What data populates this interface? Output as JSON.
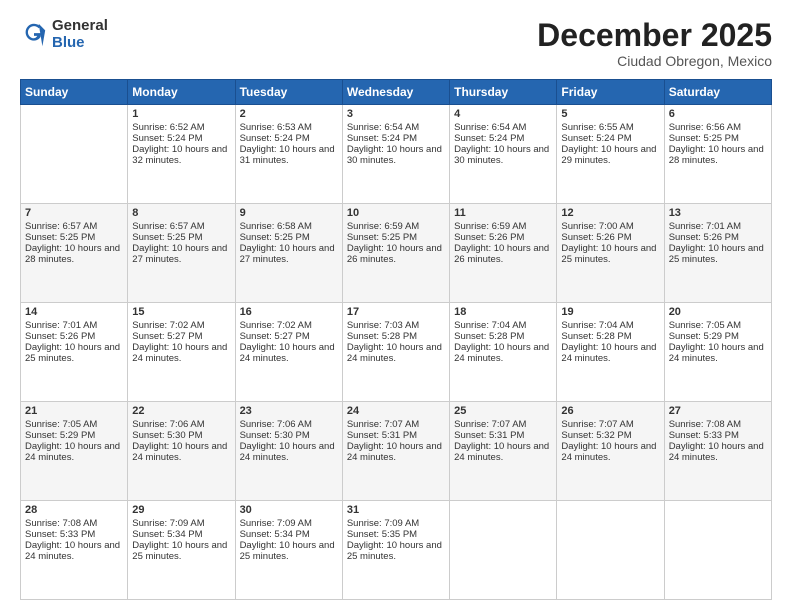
{
  "logo": {
    "general": "General",
    "blue": "Blue"
  },
  "header": {
    "month": "December 2025",
    "location": "Ciudad Obregon, Mexico"
  },
  "days_of_week": [
    "Sunday",
    "Monday",
    "Tuesday",
    "Wednesday",
    "Thursday",
    "Friday",
    "Saturday"
  ],
  "weeks": [
    [
      {
        "day": "",
        "sunrise": "",
        "sunset": "",
        "daylight": "",
        "empty": true
      },
      {
        "day": "1",
        "sunrise": "Sunrise: 6:52 AM",
        "sunset": "Sunset: 5:24 PM",
        "daylight": "Daylight: 10 hours and 32 minutes."
      },
      {
        "day": "2",
        "sunrise": "Sunrise: 6:53 AM",
        "sunset": "Sunset: 5:24 PM",
        "daylight": "Daylight: 10 hours and 31 minutes."
      },
      {
        "day": "3",
        "sunrise": "Sunrise: 6:54 AM",
        "sunset": "Sunset: 5:24 PM",
        "daylight": "Daylight: 10 hours and 30 minutes."
      },
      {
        "day": "4",
        "sunrise": "Sunrise: 6:54 AM",
        "sunset": "Sunset: 5:24 PM",
        "daylight": "Daylight: 10 hours and 30 minutes."
      },
      {
        "day": "5",
        "sunrise": "Sunrise: 6:55 AM",
        "sunset": "Sunset: 5:24 PM",
        "daylight": "Daylight: 10 hours and 29 minutes."
      },
      {
        "day": "6",
        "sunrise": "Sunrise: 6:56 AM",
        "sunset": "Sunset: 5:25 PM",
        "daylight": "Daylight: 10 hours and 28 minutes."
      }
    ],
    [
      {
        "day": "7",
        "sunrise": "Sunrise: 6:57 AM",
        "sunset": "Sunset: 5:25 PM",
        "daylight": "Daylight: 10 hours and 28 minutes."
      },
      {
        "day": "8",
        "sunrise": "Sunrise: 6:57 AM",
        "sunset": "Sunset: 5:25 PM",
        "daylight": "Daylight: 10 hours and 27 minutes."
      },
      {
        "day": "9",
        "sunrise": "Sunrise: 6:58 AM",
        "sunset": "Sunset: 5:25 PM",
        "daylight": "Daylight: 10 hours and 27 minutes."
      },
      {
        "day": "10",
        "sunrise": "Sunrise: 6:59 AM",
        "sunset": "Sunset: 5:25 PM",
        "daylight": "Daylight: 10 hours and 26 minutes."
      },
      {
        "day": "11",
        "sunrise": "Sunrise: 6:59 AM",
        "sunset": "Sunset: 5:26 PM",
        "daylight": "Daylight: 10 hours and 26 minutes."
      },
      {
        "day": "12",
        "sunrise": "Sunrise: 7:00 AM",
        "sunset": "Sunset: 5:26 PM",
        "daylight": "Daylight: 10 hours and 25 minutes."
      },
      {
        "day": "13",
        "sunrise": "Sunrise: 7:01 AM",
        "sunset": "Sunset: 5:26 PM",
        "daylight": "Daylight: 10 hours and 25 minutes."
      }
    ],
    [
      {
        "day": "14",
        "sunrise": "Sunrise: 7:01 AM",
        "sunset": "Sunset: 5:26 PM",
        "daylight": "Daylight: 10 hours and 25 minutes."
      },
      {
        "day": "15",
        "sunrise": "Sunrise: 7:02 AM",
        "sunset": "Sunset: 5:27 PM",
        "daylight": "Daylight: 10 hours and 24 minutes."
      },
      {
        "day": "16",
        "sunrise": "Sunrise: 7:02 AM",
        "sunset": "Sunset: 5:27 PM",
        "daylight": "Daylight: 10 hours and 24 minutes."
      },
      {
        "day": "17",
        "sunrise": "Sunrise: 7:03 AM",
        "sunset": "Sunset: 5:28 PM",
        "daylight": "Daylight: 10 hours and 24 minutes."
      },
      {
        "day": "18",
        "sunrise": "Sunrise: 7:04 AM",
        "sunset": "Sunset: 5:28 PM",
        "daylight": "Daylight: 10 hours and 24 minutes."
      },
      {
        "day": "19",
        "sunrise": "Sunrise: 7:04 AM",
        "sunset": "Sunset: 5:28 PM",
        "daylight": "Daylight: 10 hours and 24 minutes."
      },
      {
        "day": "20",
        "sunrise": "Sunrise: 7:05 AM",
        "sunset": "Sunset: 5:29 PM",
        "daylight": "Daylight: 10 hours and 24 minutes."
      }
    ],
    [
      {
        "day": "21",
        "sunrise": "Sunrise: 7:05 AM",
        "sunset": "Sunset: 5:29 PM",
        "daylight": "Daylight: 10 hours and 24 minutes."
      },
      {
        "day": "22",
        "sunrise": "Sunrise: 7:06 AM",
        "sunset": "Sunset: 5:30 PM",
        "daylight": "Daylight: 10 hours and 24 minutes."
      },
      {
        "day": "23",
        "sunrise": "Sunrise: 7:06 AM",
        "sunset": "Sunset: 5:30 PM",
        "daylight": "Daylight: 10 hours and 24 minutes."
      },
      {
        "day": "24",
        "sunrise": "Sunrise: 7:07 AM",
        "sunset": "Sunset: 5:31 PM",
        "daylight": "Daylight: 10 hours and 24 minutes."
      },
      {
        "day": "25",
        "sunrise": "Sunrise: 7:07 AM",
        "sunset": "Sunset: 5:31 PM",
        "daylight": "Daylight: 10 hours and 24 minutes."
      },
      {
        "day": "26",
        "sunrise": "Sunrise: 7:07 AM",
        "sunset": "Sunset: 5:32 PM",
        "daylight": "Daylight: 10 hours and 24 minutes."
      },
      {
        "day": "27",
        "sunrise": "Sunrise: 7:08 AM",
        "sunset": "Sunset: 5:33 PM",
        "daylight": "Daylight: 10 hours and 24 minutes."
      }
    ],
    [
      {
        "day": "28",
        "sunrise": "Sunrise: 7:08 AM",
        "sunset": "Sunset: 5:33 PM",
        "daylight": "Daylight: 10 hours and 24 minutes."
      },
      {
        "day": "29",
        "sunrise": "Sunrise: 7:09 AM",
        "sunset": "Sunset: 5:34 PM",
        "daylight": "Daylight: 10 hours and 25 minutes."
      },
      {
        "day": "30",
        "sunrise": "Sunrise: 7:09 AM",
        "sunset": "Sunset: 5:34 PM",
        "daylight": "Daylight: 10 hours and 25 minutes."
      },
      {
        "day": "31",
        "sunrise": "Sunrise: 7:09 AM",
        "sunset": "Sunset: 5:35 PM",
        "daylight": "Daylight: 10 hours and 25 minutes."
      },
      {
        "day": "",
        "sunrise": "",
        "sunset": "",
        "daylight": "",
        "empty": true
      },
      {
        "day": "",
        "sunrise": "",
        "sunset": "",
        "daylight": "",
        "empty": true
      },
      {
        "day": "",
        "sunrise": "",
        "sunset": "",
        "daylight": "",
        "empty": true
      }
    ]
  ]
}
